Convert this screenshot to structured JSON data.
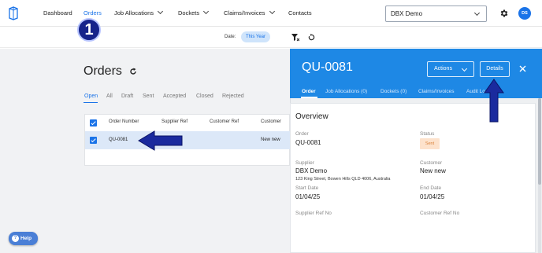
{
  "nav": {
    "items": [
      {
        "label": "Dashboard"
      },
      {
        "label": "Orders"
      },
      {
        "label": "Job Allocations"
      },
      {
        "label": "Dockets"
      },
      {
        "label": "Claims/Invoices"
      },
      {
        "label": "Contacts"
      }
    ],
    "org_select": "DBX Demo",
    "avatar_initials": "DS"
  },
  "filters": {
    "date_label": "Date:",
    "date_value": "This Year"
  },
  "page": {
    "title": "Orders",
    "status_tabs": [
      "Open",
      "All",
      "Draft",
      "Sent",
      "Accepted",
      "Closed",
      "Rejected"
    ],
    "active_tab": "Open"
  },
  "table": {
    "columns": [
      "Order Number",
      "Supplier Ref",
      "Customer Ref",
      "Customer"
    ],
    "rows": [
      {
        "order_number": "QU-0081",
        "supplier_ref": "",
        "customer_ref": "",
        "customer": "New new"
      }
    ]
  },
  "help": {
    "label": "Help"
  },
  "panel": {
    "title": "QU-0081",
    "actions_label": "Actions",
    "details_label": "Details",
    "tabs": [
      "Order",
      "Job Allocations (0)",
      "Dockets (0)",
      "Claims/Invoices",
      "Audit Lo"
    ],
    "overview": {
      "heading": "Overview",
      "order_label": "Order",
      "order_value": "QU-0081",
      "status_label": "Status",
      "status_value": "Sent",
      "supplier_label": "Supplier",
      "supplier_name": "DBX Demo",
      "supplier_address": "123 King Street, Bowen Hills QLD 4006, Australia",
      "customer_label": "Customer",
      "customer_value": "New new",
      "start_label": "Start Date",
      "start_value": "01/04/25",
      "end_label": "End Date",
      "end_value": "01/04/25",
      "supplier_ref_label": "Supplier Ref No",
      "customer_ref_label": "Customer Ref No"
    }
  },
  "annotation": {
    "step_number": "1"
  },
  "colors": {
    "accent": "#1a73e8",
    "panel_header": "#1e88e5",
    "arrow": "#1a2a9e",
    "status_sent_bg": "#fde2cc"
  }
}
